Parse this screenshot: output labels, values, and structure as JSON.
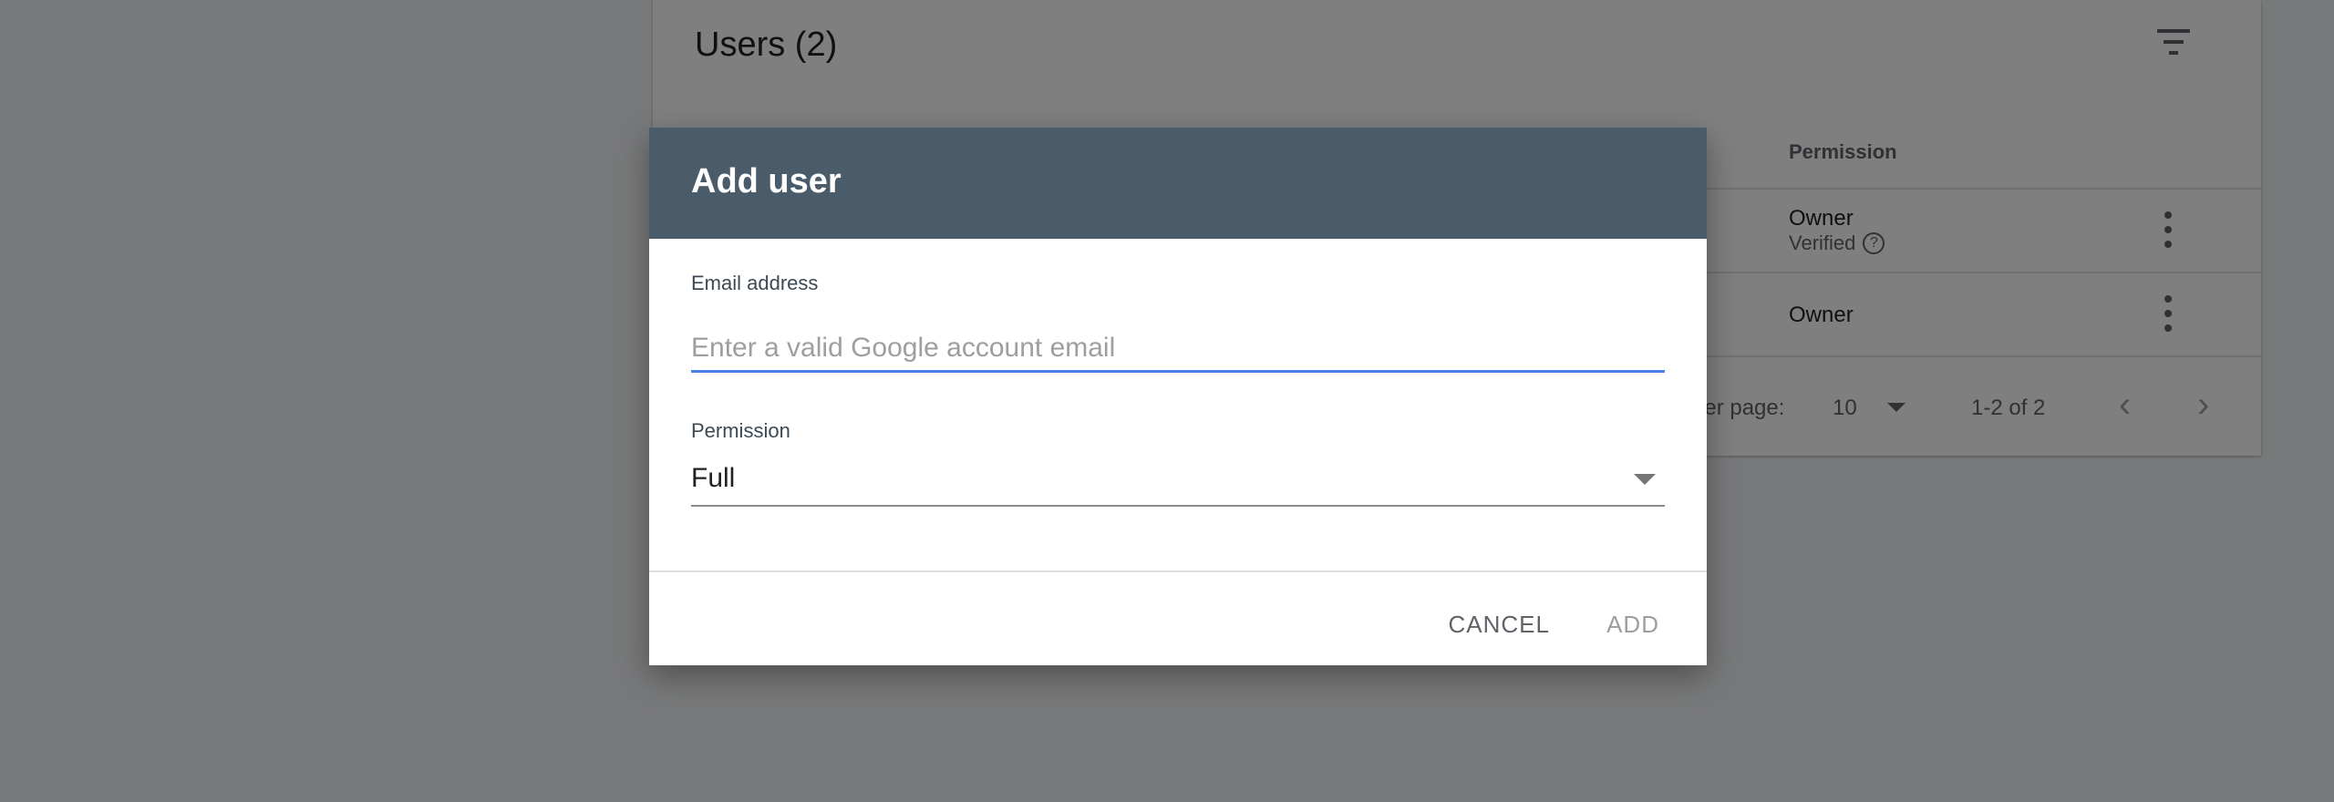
{
  "users_card": {
    "title": "Users (2)",
    "columns": {
      "permission": "Permission"
    },
    "rows": [
      {
        "permission": "Owner",
        "status": "Verified"
      },
      {
        "permission": "Owner"
      }
    ],
    "pager": {
      "rows_per_page_label": "per page:",
      "rows_per_page_value": "10",
      "range": "1-2 of 2"
    }
  },
  "icons": {
    "filter": "filter-icon",
    "help": "help-icon",
    "more": "more-vert-icon",
    "dropdown": "chevron-down-icon",
    "prev": "chevron-left-icon",
    "next": "chevron-right-icon"
  },
  "dialog": {
    "title": "Add user",
    "email_label": "Email address",
    "email_value": "",
    "email_placeholder": "Enter a valid Google account email",
    "permission_label": "Permission",
    "permission_value": "Full",
    "cancel_label": "CANCEL",
    "add_label": "ADD"
  },
  "colors": {
    "dialog_header": "#4a5c6a",
    "input_focus": "#4a80e8",
    "scrim": "#7f7f7f"
  }
}
